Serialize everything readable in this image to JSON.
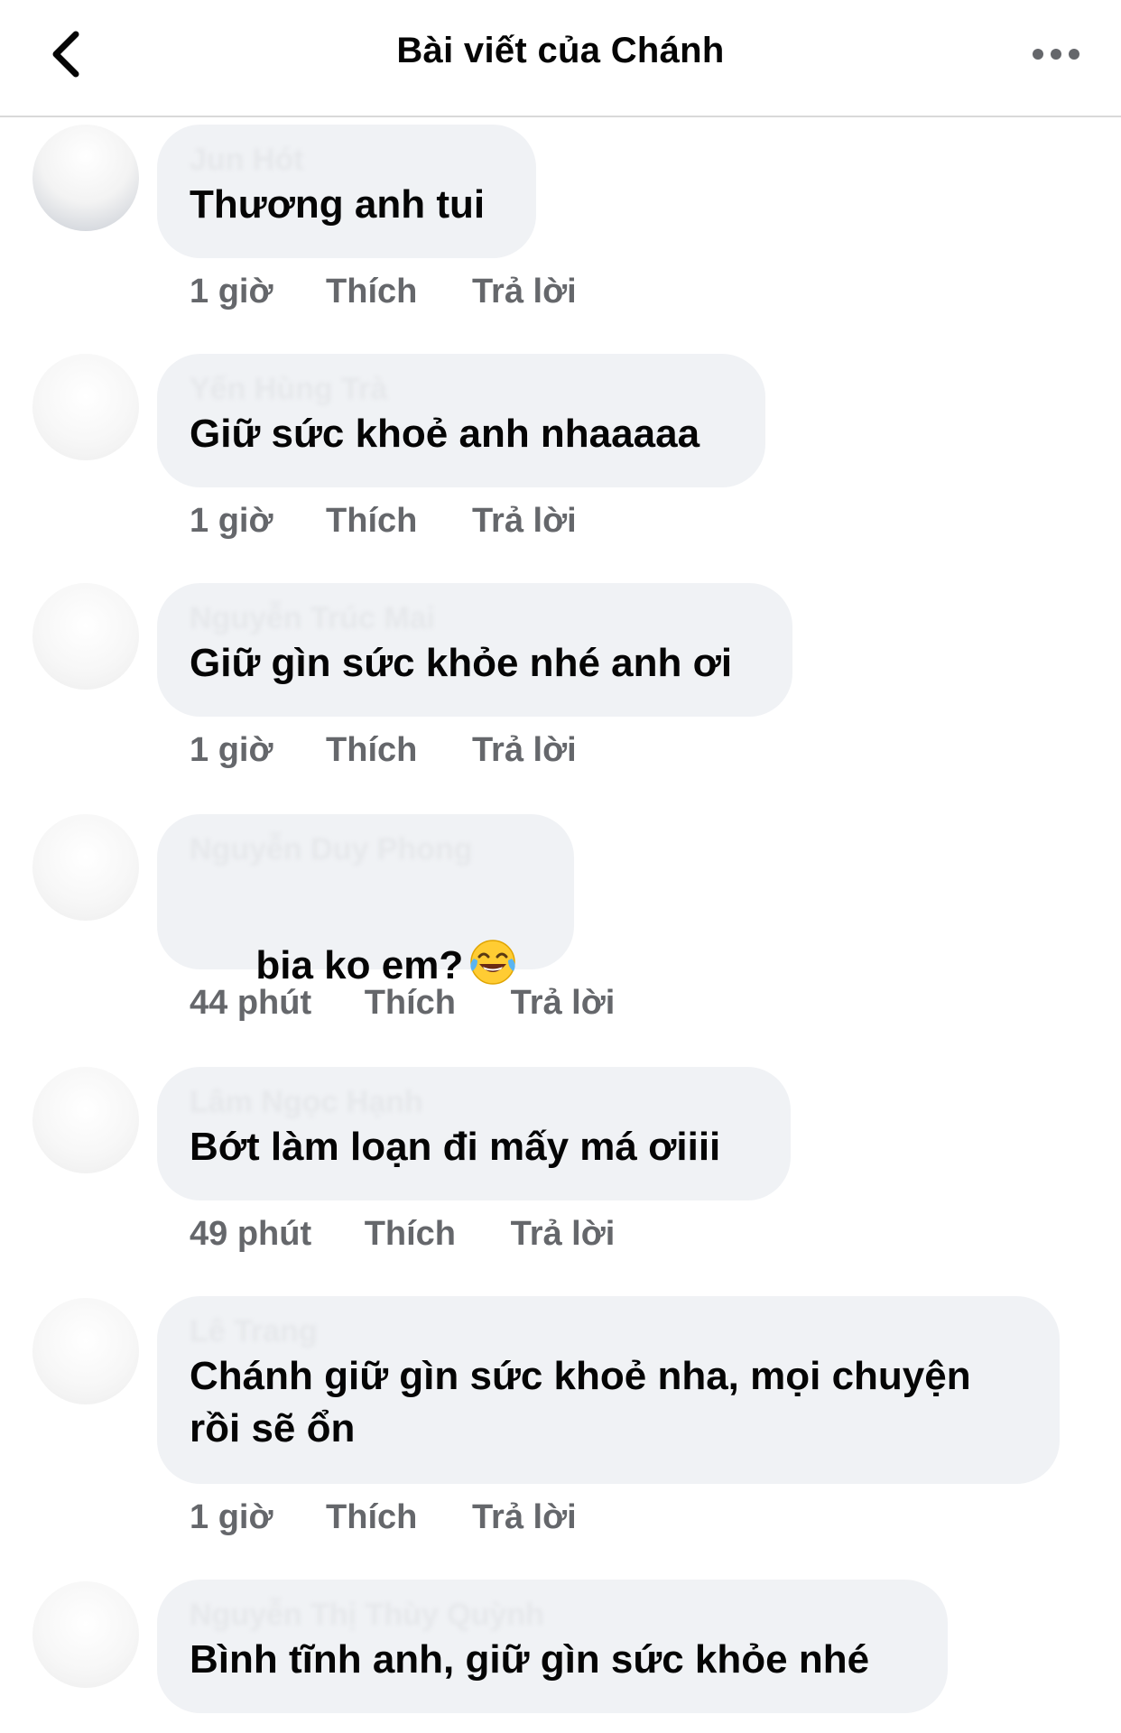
{
  "header": {
    "title": "Bài viết của Chánh",
    "back_icon": "chevron-left-icon",
    "more_icon": "more-horizontal-icon"
  },
  "comments": [
    {
      "author": "Jun Hót",
      "text": "Thương anh tui",
      "time": "1 giờ",
      "like": "Thích",
      "reply": "Trả lời"
    },
    {
      "author": "Yến Hùng Trà",
      "text": "Giữ sức khoẻ anh nhaaaaa",
      "time": "1 giờ",
      "like": "Thích",
      "reply": "Trả lời"
    },
    {
      "author": "Nguyễn Trúc Mai",
      "text": "Giữ gìn sức khỏe nhé anh ơi",
      "time": "1 giờ",
      "like": "Thích",
      "reply": "Trả lời"
    },
    {
      "author": "Nguyễn Duy Phong",
      "text": "bia ko em?",
      "emoji": "tears-of-joy-emoji",
      "time": "44 phút",
      "like": "Thích",
      "reply": "Trả lời"
    },
    {
      "author": "Lâm Ngọc Hạnh",
      "text": "Bớt làm loạn đi mấy má ơiiii",
      "time": "49 phút",
      "like": "Thích",
      "reply": "Trả lời"
    },
    {
      "author": "Lê Trang",
      "text": "Chánh giữ gìn sức khoẻ nha, mọi chuyện\nrồi sẽ ổn",
      "time": "1 giờ",
      "like": "Thích",
      "reply": "Trả lời"
    },
    {
      "author": "Nguyễn Thị Thùy Quỳnh",
      "text": "Bình tĩnh anh, giữ gìn sức khỏe nhé"
    }
  ]
}
